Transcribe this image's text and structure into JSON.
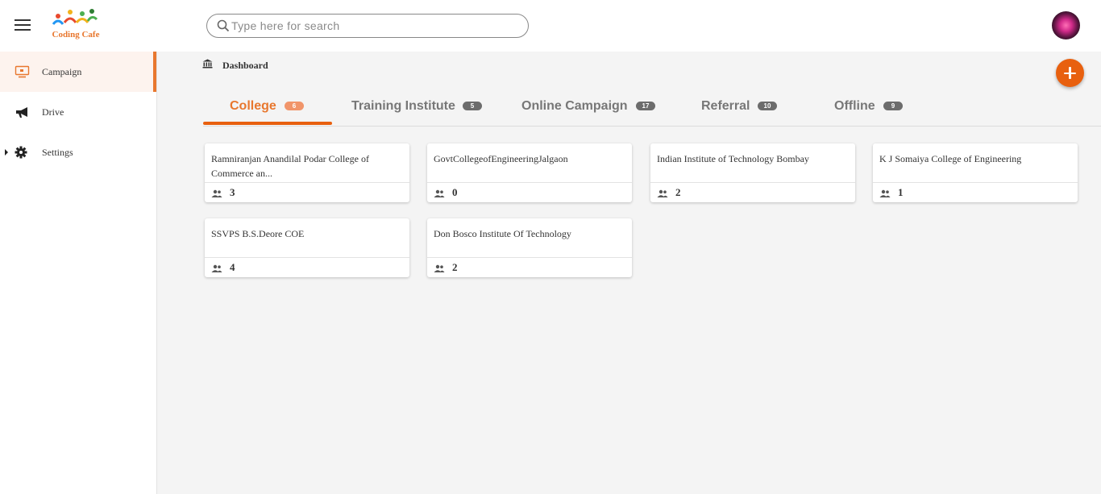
{
  "header": {
    "logo_text": "Coding Cafe",
    "search": {
      "placeholder": "Type here for search",
      "value": ""
    }
  },
  "sidebar": {
    "items": [
      {
        "label": "Campaign",
        "icon": "monitor-icon",
        "active": true
      },
      {
        "label": "Drive",
        "icon": "megaphone-icon",
        "active": false
      },
      {
        "label": "Settings",
        "icon": "gear-icon",
        "active": false
      }
    ]
  },
  "breadcrumb": {
    "label": "Dashboard",
    "icon": "bank-icon"
  },
  "tabs": [
    {
      "label": "College",
      "count": "6",
      "active": true
    },
    {
      "label": "Training Institute",
      "count": "5",
      "active": false
    },
    {
      "label": "Online Campaign",
      "count": "17",
      "active": false
    },
    {
      "label": "Referral",
      "count": "10",
      "active": false
    },
    {
      "label": "Offline",
      "count": "9",
      "active": false
    }
  ],
  "cards": [
    {
      "title": "Ramniranjan Anandilal Podar College of Commerce an...",
      "count": "3"
    },
    {
      "title": "GovtCollegeofEngineeringJalgaon",
      "count": "0"
    },
    {
      "title": "Indian Institute of Technology Bombay",
      "count": "2"
    },
    {
      "title": "K J Somaiya College of Engineering",
      "count": "1"
    },
    {
      "title": "SSVPS B.S.Deore COE",
      "count": "4"
    },
    {
      "title": "Don Bosco Institute Of Technology",
      "count": "2"
    }
  ],
  "colors": {
    "accent": "#e8772e",
    "fab": "#e8600f",
    "badge": "#6c6c6c"
  }
}
